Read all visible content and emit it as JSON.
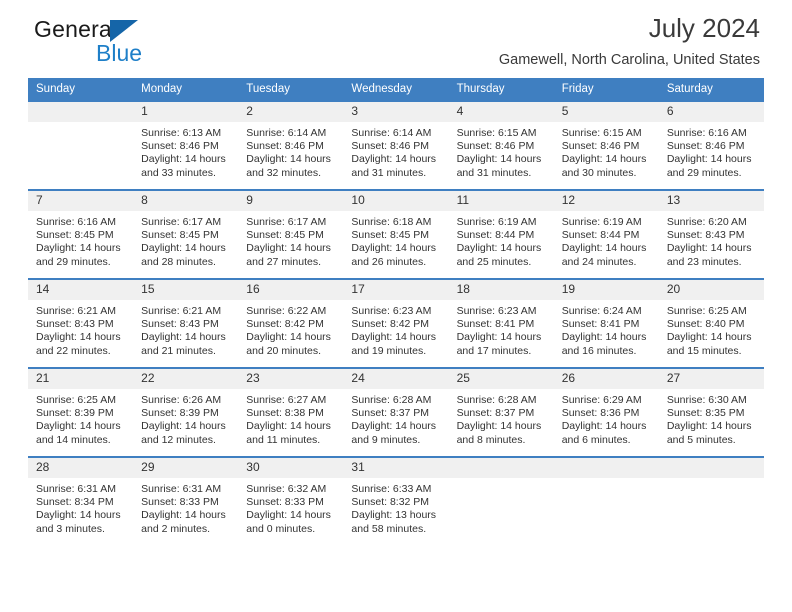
{
  "brand": {
    "name_part1": "General",
    "name_part2": "Blue",
    "accent_color": "#1e7fc8",
    "triangle_color": "#1565a8"
  },
  "header": {
    "title": "July 2024",
    "location": "Gamewell, North Carolina, United States"
  },
  "calendar": {
    "header_bg": "#3f7fc1",
    "daynum_bg": "#f0f0f0",
    "weekday_headers": [
      "Sunday",
      "Monday",
      "Tuesday",
      "Wednesday",
      "Thursday",
      "Friday",
      "Saturday"
    ],
    "weeks": [
      [
        {
          "day": "",
          "sunrise": "",
          "sunset": "",
          "daylight1": "",
          "daylight2": ""
        },
        {
          "day": "1",
          "sunrise": "Sunrise: 6:13 AM",
          "sunset": "Sunset: 8:46 PM",
          "daylight1": "Daylight: 14 hours",
          "daylight2": "and 33 minutes."
        },
        {
          "day": "2",
          "sunrise": "Sunrise: 6:14 AM",
          "sunset": "Sunset: 8:46 PM",
          "daylight1": "Daylight: 14 hours",
          "daylight2": "and 32 minutes."
        },
        {
          "day": "3",
          "sunrise": "Sunrise: 6:14 AM",
          "sunset": "Sunset: 8:46 PM",
          "daylight1": "Daylight: 14 hours",
          "daylight2": "and 31 minutes."
        },
        {
          "day": "4",
          "sunrise": "Sunrise: 6:15 AM",
          "sunset": "Sunset: 8:46 PM",
          "daylight1": "Daylight: 14 hours",
          "daylight2": "and 31 minutes."
        },
        {
          "day": "5",
          "sunrise": "Sunrise: 6:15 AM",
          "sunset": "Sunset: 8:46 PM",
          "daylight1": "Daylight: 14 hours",
          "daylight2": "and 30 minutes."
        },
        {
          "day": "6",
          "sunrise": "Sunrise: 6:16 AM",
          "sunset": "Sunset: 8:46 PM",
          "daylight1": "Daylight: 14 hours",
          "daylight2": "and 29 minutes."
        }
      ],
      [
        {
          "day": "7",
          "sunrise": "Sunrise: 6:16 AM",
          "sunset": "Sunset: 8:45 PM",
          "daylight1": "Daylight: 14 hours",
          "daylight2": "and 29 minutes."
        },
        {
          "day": "8",
          "sunrise": "Sunrise: 6:17 AM",
          "sunset": "Sunset: 8:45 PM",
          "daylight1": "Daylight: 14 hours",
          "daylight2": "and 28 minutes."
        },
        {
          "day": "9",
          "sunrise": "Sunrise: 6:17 AM",
          "sunset": "Sunset: 8:45 PM",
          "daylight1": "Daylight: 14 hours",
          "daylight2": "and 27 minutes."
        },
        {
          "day": "10",
          "sunrise": "Sunrise: 6:18 AM",
          "sunset": "Sunset: 8:45 PM",
          "daylight1": "Daylight: 14 hours",
          "daylight2": "and 26 minutes."
        },
        {
          "day": "11",
          "sunrise": "Sunrise: 6:19 AM",
          "sunset": "Sunset: 8:44 PM",
          "daylight1": "Daylight: 14 hours",
          "daylight2": "and 25 minutes."
        },
        {
          "day": "12",
          "sunrise": "Sunrise: 6:19 AM",
          "sunset": "Sunset: 8:44 PM",
          "daylight1": "Daylight: 14 hours",
          "daylight2": "and 24 minutes."
        },
        {
          "day": "13",
          "sunrise": "Sunrise: 6:20 AM",
          "sunset": "Sunset: 8:43 PM",
          "daylight1": "Daylight: 14 hours",
          "daylight2": "and 23 minutes."
        }
      ],
      [
        {
          "day": "14",
          "sunrise": "Sunrise: 6:21 AM",
          "sunset": "Sunset: 8:43 PM",
          "daylight1": "Daylight: 14 hours",
          "daylight2": "and 22 minutes."
        },
        {
          "day": "15",
          "sunrise": "Sunrise: 6:21 AM",
          "sunset": "Sunset: 8:43 PM",
          "daylight1": "Daylight: 14 hours",
          "daylight2": "and 21 minutes."
        },
        {
          "day": "16",
          "sunrise": "Sunrise: 6:22 AM",
          "sunset": "Sunset: 8:42 PM",
          "daylight1": "Daylight: 14 hours",
          "daylight2": "and 20 minutes."
        },
        {
          "day": "17",
          "sunrise": "Sunrise: 6:23 AM",
          "sunset": "Sunset: 8:42 PM",
          "daylight1": "Daylight: 14 hours",
          "daylight2": "and 19 minutes."
        },
        {
          "day": "18",
          "sunrise": "Sunrise: 6:23 AM",
          "sunset": "Sunset: 8:41 PM",
          "daylight1": "Daylight: 14 hours",
          "daylight2": "and 17 minutes."
        },
        {
          "day": "19",
          "sunrise": "Sunrise: 6:24 AM",
          "sunset": "Sunset: 8:41 PM",
          "daylight1": "Daylight: 14 hours",
          "daylight2": "and 16 minutes."
        },
        {
          "day": "20",
          "sunrise": "Sunrise: 6:25 AM",
          "sunset": "Sunset: 8:40 PM",
          "daylight1": "Daylight: 14 hours",
          "daylight2": "and 15 minutes."
        }
      ],
      [
        {
          "day": "21",
          "sunrise": "Sunrise: 6:25 AM",
          "sunset": "Sunset: 8:39 PM",
          "daylight1": "Daylight: 14 hours",
          "daylight2": "and 14 minutes."
        },
        {
          "day": "22",
          "sunrise": "Sunrise: 6:26 AM",
          "sunset": "Sunset: 8:39 PM",
          "daylight1": "Daylight: 14 hours",
          "daylight2": "and 12 minutes."
        },
        {
          "day": "23",
          "sunrise": "Sunrise: 6:27 AM",
          "sunset": "Sunset: 8:38 PM",
          "daylight1": "Daylight: 14 hours",
          "daylight2": "and 11 minutes."
        },
        {
          "day": "24",
          "sunrise": "Sunrise: 6:28 AM",
          "sunset": "Sunset: 8:37 PM",
          "daylight1": "Daylight: 14 hours",
          "daylight2": "and 9 minutes."
        },
        {
          "day": "25",
          "sunrise": "Sunrise: 6:28 AM",
          "sunset": "Sunset: 8:37 PM",
          "daylight1": "Daylight: 14 hours",
          "daylight2": "and 8 minutes."
        },
        {
          "day": "26",
          "sunrise": "Sunrise: 6:29 AM",
          "sunset": "Sunset: 8:36 PM",
          "daylight1": "Daylight: 14 hours",
          "daylight2": "and 6 minutes."
        },
        {
          "day": "27",
          "sunrise": "Sunrise: 6:30 AM",
          "sunset": "Sunset: 8:35 PM",
          "daylight1": "Daylight: 14 hours",
          "daylight2": "and 5 minutes."
        }
      ],
      [
        {
          "day": "28",
          "sunrise": "Sunrise: 6:31 AM",
          "sunset": "Sunset: 8:34 PM",
          "daylight1": "Daylight: 14 hours",
          "daylight2": "and 3 minutes."
        },
        {
          "day": "29",
          "sunrise": "Sunrise: 6:31 AM",
          "sunset": "Sunset: 8:33 PM",
          "daylight1": "Daylight: 14 hours",
          "daylight2": "and 2 minutes."
        },
        {
          "day": "30",
          "sunrise": "Sunrise: 6:32 AM",
          "sunset": "Sunset: 8:33 PM",
          "daylight1": "Daylight: 14 hours",
          "daylight2": "and 0 minutes."
        },
        {
          "day": "31",
          "sunrise": "Sunrise: 6:33 AM",
          "sunset": "Sunset: 8:32 PM",
          "daylight1": "Daylight: 13 hours",
          "daylight2": "and 58 minutes."
        },
        {
          "day": "",
          "sunrise": "",
          "sunset": "",
          "daylight1": "",
          "daylight2": ""
        },
        {
          "day": "",
          "sunrise": "",
          "sunset": "",
          "daylight1": "",
          "daylight2": ""
        },
        {
          "day": "",
          "sunrise": "",
          "sunset": "",
          "daylight1": "",
          "daylight2": ""
        }
      ]
    ]
  }
}
